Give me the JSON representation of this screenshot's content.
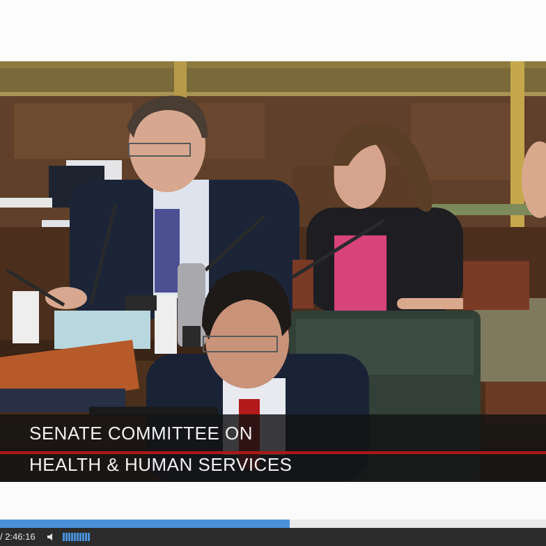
{
  "video": {
    "caption_line1": "SENATE COMMITTEE ON",
    "caption_line2": "HEALTH & HUMAN SERVICES",
    "accent_color": "#b01818"
  },
  "player": {
    "time_display": "/ 2:46:16",
    "progress_fraction": 0.53,
    "volume_bars": 10,
    "progress_color": "#4a90d9",
    "icons": [
      "speaker-icon"
    ]
  }
}
